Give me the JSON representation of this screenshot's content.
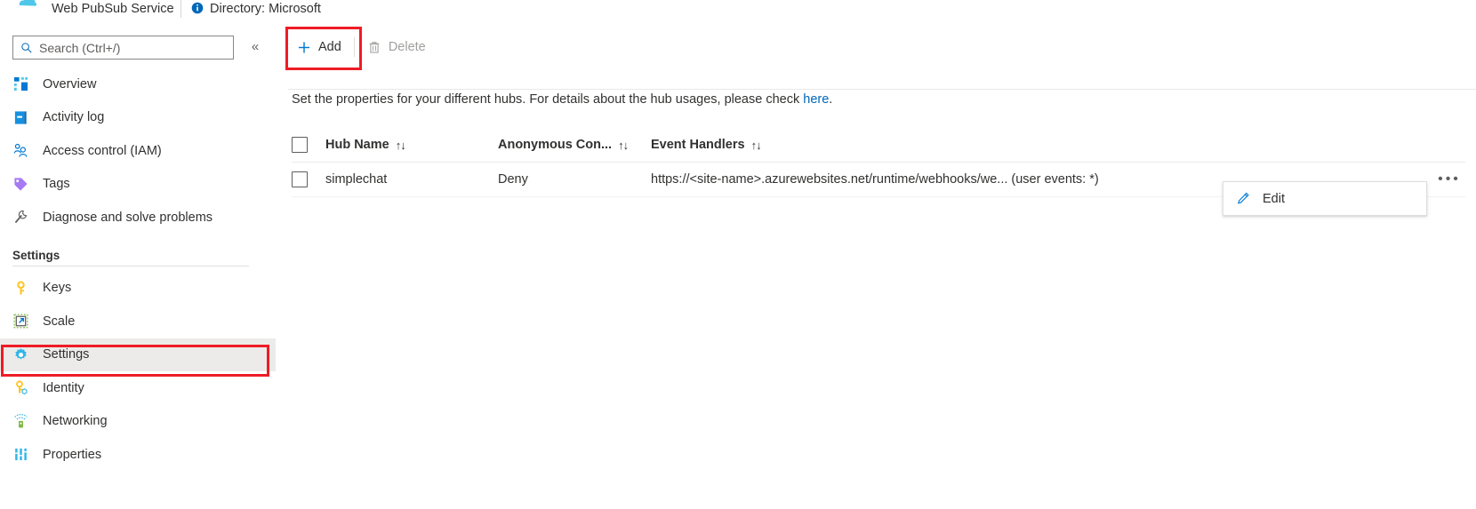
{
  "header": {
    "resource_icon": "web-pubsub-cloud-icon",
    "resource_title": "Web PubSub Service",
    "info_icon": "info-icon",
    "directory_label": "Directory: Microsoft"
  },
  "sidebar": {
    "search": {
      "icon": "search-icon",
      "placeholder": "Search (Ctrl+/)",
      "value": ""
    },
    "collapse_icon": "double-chevron-left-icon",
    "items": [
      {
        "label": "Overview",
        "icon": "overview-grid-icon",
        "selected": false
      },
      {
        "label": "Activity log",
        "icon": "activity-log-icon",
        "selected": false
      },
      {
        "label": "Access control (IAM)",
        "icon": "access-control-people-icon",
        "selected": false
      },
      {
        "label": "Tags",
        "icon": "tag-icon",
        "selected": false
      },
      {
        "label": "Diagnose and solve problems",
        "icon": "wrench-icon",
        "selected": false
      }
    ],
    "group_title": "Settings",
    "settings_items": [
      {
        "label": "Keys",
        "icon": "key-icon",
        "selected": false
      },
      {
        "label": "Scale",
        "icon": "scale-arrow-icon",
        "selected": false
      },
      {
        "label": "Settings",
        "icon": "gear-icon",
        "selected": true
      },
      {
        "label": "Identity",
        "icon": "identity-key-icon",
        "selected": false
      },
      {
        "label": "Networking",
        "icon": "networking-icon",
        "selected": false
      },
      {
        "label": "Properties",
        "icon": "properties-bars-icon",
        "selected": false
      }
    ]
  },
  "toolbar": {
    "add_label": "Add",
    "add_icon": "plus-icon",
    "delete_label": "Delete",
    "delete_icon": "trash-icon",
    "delete_disabled": true
  },
  "description": {
    "text_before": "Set the properties for your different hubs. For details about the hub usages, please check ",
    "link_label": "here",
    "text_after": "."
  },
  "table": {
    "columns": [
      {
        "label": "Hub Name",
        "sort_icon": "sort-updown-icon"
      },
      {
        "label": "Anonymous Con...",
        "sort_icon": "sort-updown-icon"
      },
      {
        "label": "Event Handlers",
        "sort_icon": "sort-updown-icon"
      }
    ],
    "rows": [
      {
        "hub_name": "simplechat",
        "anonymous_connect": "Deny",
        "event_handlers": "https://<site-name>.azurewebsites.net/runtime/webhooks/we... (user events: *)",
        "more_icon": "ellipsis-icon"
      }
    ]
  },
  "context_menu": {
    "items": [
      {
        "label": "Edit",
        "icon": "pencil-edit-icon"
      }
    ]
  },
  "annotations": {
    "highlight_color": "#ee1c25",
    "boxes": [
      "add-button-highlight",
      "settings-nav-highlight"
    ]
  }
}
